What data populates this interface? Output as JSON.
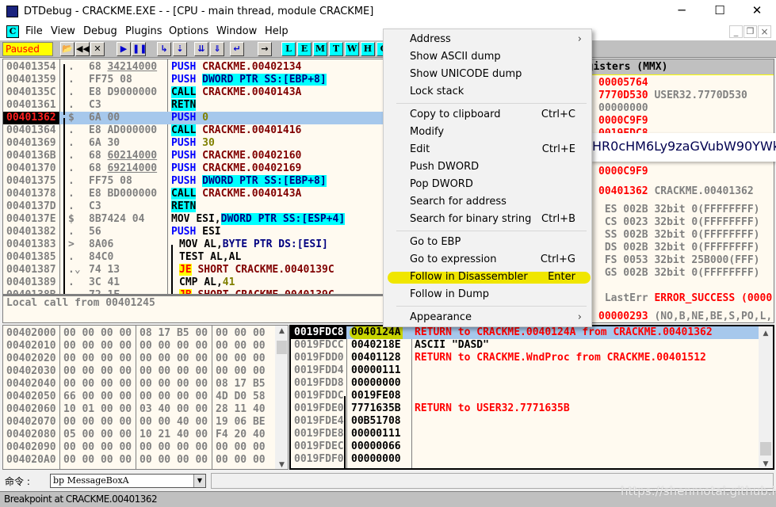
{
  "window": {
    "title": "DTDebug - CRACKME.EXE - - [CPU - main thread, module CRACKME]",
    "minimize": "─",
    "maximize": "☐",
    "close": "✕"
  },
  "menubar": {
    "icon": "C",
    "items": [
      "File",
      "View",
      "Debug",
      "Plugins",
      "Options",
      "Window",
      "Help"
    ],
    "mdi": [
      "_",
      "❐",
      "×"
    ]
  },
  "toolbar": {
    "status": "Paused",
    "status_color": "#ffff00",
    "buttons": [
      {
        "name": "open-icon",
        "g": "📂"
      },
      {
        "name": "restart-icon",
        "g": "◀◀"
      },
      {
        "name": "close-icon",
        "g": "✕"
      },
      {
        "name": "run-icon",
        "g": "▶"
      },
      {
        "name": "pause-icon",
        "g": "❚❚"
      },
      {
        "name": "step-into-icon",
        "g": "↳"
      },
      {
        "name": "step-over-icon",
        "g": "⇣"
      },
      {
        "name": "trace-into-icon",
        "g": "⇊"
      },
      {
        "name": "trace-over-icon",
        "g": "⇓"
      },
      {
        "name": "execute-till-return-icon",
        "g": "↵"
      },
      {
        "name": "goto-icon",
        "g": "→"
      }
    ],
    "letters": [
      "L",
      "E",
      "M",
      "T",
      "W",
      "H",
      "C"
    ]
  },
  "disasm": {
    "rows": [
      {
        "addr": "00401354",
        "mark": ".",
        "h1": "68 ",
        "h2": "34214000",
        "mn": "PUSH",
        "mc": "push",
        "ops": [
          [
            "CRACKME.00402134",
            "red"
          ]
        ]
      },
      {
        "addr": "00401359",
        "mark": ".",
        "h1": "FF75 08",
        "h2": "",
        "mn": "PUSH",
        "mc": "push",
        "ops": [
          [
            "DWORD PTR SS:[EBP+8]",
            "navyc"
          ]
        ]
      },
      {
        "addr": "0040135C",
        "mark": ".",
        "h1": "E8 D9000000",
        "h2": "",
        "mn": "CALL",
        "mc": "cyan",
        "ops": [
          [
            "CRACKME.0040143A",
            "red"
          ]
        ]
      },
      {
        "addr": "00401361",
        "mark": ".",
        "h1": "C3",
        "h2": "",
        "mn": "RETN",
        "mc": "cyan",
        "ops": []
      },
      {
        "addr": "00401362",
        "mark": "$",
        "h1": "6A 00",
        "h2": "",
        "mn": "PUSH",
        "mc": "push",
        "ops": [
          [
            "0",
            "olive"
          ]
        ],
        "selected": true
      },
      {
        "addr": "00401364",
        "mark": ".",
        "h1": "E8 AD000000",
        "h2": "",
        "mn": "CALL",
        "mc": "cyan",
        "ops": [
          [
            "CRACKME.00401416",
            "red"
          ]
        ]
      },
      {
        "addr": "00401369",
        "mark": ".",
        "h1": "6A 30",
        "h2": "",
        "mn": "PUSH",
        "mc": "push",
        "ops": [
          [
            "30",
            "olive"
          ]
        ]
      },
      {
        "addr": "0040136B",
        "mark": ".",
        "h1": "68 ",
        "h2": "60214000",
        "mn": "PUSH",
        "mc": "push",
        "ops": [
          [
            "CRACKME.00402160",
            "red"
          ]
        ]
      },
      {
        "addr": "00401370",
        "mark": ".",
        "h1": "68 ",
        "h2": "69214000",
        "mn": "PUSH",
        "mc": "push",
        "ops": [
          [
            "CRACKME.00402169",
            "red"
          ]
        ]
      },
      {
        "addr": "00401375",
        "mark": ".",
        "h1": "FF75 08",
        "h2": "",
        "mn": "PUSH",
        "mc": "push",
        "ops": [
          [
            "DWORD PTR SS:[EBP+8]",
            "navyc"
          ]
        ]
      },
      {
        "addr": "00401378",
        "mark": ".",
        "h1": "E8 BD000000",
        "h2": "",
        "mn": "CALL",
        "mc": "cyan",
        "ops": [
          [
            "CRACKME.0040143A",
            "red"
          ]
        ]
      },
      {
        "addr": "0040137D",
        "mark": ".",
        "h1": "C3",
        "h2": "",
        "mn": "RETN",
        "mc": "cyan",
        "ops": []
      },
      {
        "addr": "0040137E",
        "mark": "$",
        "h1": "8B7424 04",
        "h2": "",
        "mn": "MOV",
        "mc": "blk",
        "ops": [
          [
            "ESI,",
            "blk"
          ],
          [
            "DWORD PTR SS:[ESP+4]",
            "navyc"
          ]
        ]
      },
      {
        "addr": "00401382",
        "mark": ".",
        "h1": "56",
        "h2": "",
        "mn": "PUSH",
        "mc": "push",
        "ops": [
          [
            "ESI",
            "blk"
          ]
        ]
      },
      {
        "addr": "00401383",
        "mark": ">",
        "h1": "8A06",
        "h2": "",
        "mn": "MOV",
        "mc": "blk",
        "ops": [
          [
            "AL,",
            "blk"
          ],
          [
            "BYTE PTR DS:[ESI]",
            "navy"
          ]
        ],
        "indent": true
      },
      {
        "addr": "00401385",
        "mark": ".",
        "h1": "84C0",
        "h2": "",
        "mn": "TEST",
        "mc": "blk",
        "ops": [
          [
            "AL,AL",
            "blk"
          ]
        ],
        "indent": true
      },
      {
        "addr": "00401387",
        "mark": ".⌄",
        "h1": "74 13",
        "h2": "",
        "mn": "JE",
        "mc": "jmp",
        "ops": [
          [
            "SHORT CRACKME.0040139C",
            "red"
          ]
        ],
        "indent": true
      },
      {
        "addr": "00401389",
        "mark": ".",
        "h1": "3C 41",
        "h2": "",
        "mn": "CMP",
        "mc": "blk",
        "ops": [
          [
            "AL,",
            "blk"
          ],
          [
            "41",
            "olive"
          ]
        ],
        "indent": true
      },
      {
        "addr": "0040138B",
        "mark": ".",
        "h1": "72 1F",
        "h2": "",
        "mn": "JB",
        "mc": "jmp",
        "ops": [
          [
            "SHORT CRACKME.0040139C",
            "red"
          ]
        ],
        "indent": true
      }
    ]
  },
  "info": {
    "text": "Local call from 00401245"
  },
  "registers": {
    "header": "Registers (MMX)",
    "rows": [
      {
        "v": "00005764",
        "c": "rr",
        "d": ""
      },
      {
        "v": "7770D530",
        "c": "rr",
        "d": "USER32.7770D530"
      },
      {
        "v": "00000000",
        "c": "gray",
        "d": ""
      },
      {
        "v": "0000C9F9",
        "c": "rr",
        "d": ""
      },
      {
        "v": "0019FDC8",
        "c": "rr",
        "d": ""
      },
      {
        "v": "0000C9F9",
        "c": "rr",
        "d": "",
        "gap": true
      },
      {
        "v": "00401362",
        "c": "rr",
        "d": "CRACKME.00401362"
      }
    ],
    "segments": [
      " ES 002B 32bit 0(FFFFFFFF)",
      " CS 0023 32bit 0(FFFFFFFF)",
      " SS 002B 32bit 0(FFFFFFFF)",
      " DS 002B 32bit 0(FFFFFFFF)",
      " FS 0053 32bit 25B000(FFF)",
      " GS 002B 32bit 0(FFFFFFFF)"
    ],
    "lasterr_label": " LastErr",
    "lasterr": "ERROR_SUCCESS (0000",
    "eflags": "00000293",
    "flags": "(NO,B,NE,BE,S,PO,L,"
  },
  "tooltip": {
    "text": "HR0cHM6Ly9zaGVubW90YWkuZ"
  },
  "dump": {
    "rows": [
      [
        "00402000",
        "00 00 00 00",
        "08 17 B5 00",
        "00 00 00"
      ],
      [
        "00402010",
        "00 00 00 00",
        "00 00 00 00",
        "00 00 00"
      ],
      [
        "00402020",
        "00 00 00 00",
        "00 00 00 00",
        "00 00 00"
      ],
      [
        "00402030",
        "00 00 00 00",
        "00 00 00 00",
        "00 00 00"
      ],
      [
        "00402040",
        "00 00 00 00",
        "00 00 00 00",
        "08 17 B5"
      ],
      [
        "00402050",
        "66 00 00 00",
        "00 00 00 00",
        "4D D0 58"
      ],
      [
        "00402060",
        "10 01 00 00",
        "03 40 00 00",
        "28 11 40"
      ],
      [
        "00402070",
        "00 00 00 00",
        "00 00 40 00",
        "19 06 BE"
      ],
      [
        "00402080",
        "05 00 00 00",
        "10 21 40 00",
        "F4 20 40"
      ],
      [
        "00402090",
        "00 00 00 00",
        "00 00 00 00",
        "00 00 00"
      ],
      [
        "004020A0",
        "00 00 00 00",
        "00 00 00 00",
        "00 00 00"
      ]
    ]
  },
  "stack": {
    "rows": [
      [
        "0019FDC8",
        "0040124A",
        "RETURN to CRACKME.0040124A from CRACKME.00401362",
        "rr"
      ],
      [
        "0019FDCC",
        "0040218E",
        "ASCII \"DASD\"",
        "blk"
      ],
      [
        "0019FDD0",
        "00401128",
        "RETURN to CRACKME.WndProc from CRACKME.00401512",
        "rr"
      ],
      [
        "0019FDD4",
        "00000111",
        "",
        ""
      ],
      [
        "0019FDD8",
        "00000000",
        "",
        ""
      ],
      [
        "0019FDDC",
        "0019FE08",
        "",
        ""
      ],
      [
        "0019FDE0",
        "7771635B",
        "RETURN to USER32.7771635B",
        "rr"
      ],
      [
        "0019FDE4",
        "00B51708",
        "",
        ""
      ],
      [
        "0019FDE8",
        "00000111",
        "",
        ""
      ],
      [
        "0019FDEC",
        "00000066",
        "",
        ""
      ],
      [
        "0019FDF0",
        "00000000",
        "",
        ""
      ]
    ]
  },
  "context_menu": {
    "items": [
      {
        "label": "Address",
        "shortcut": "",
        "sub": true
      },
      {
        "label": "Show ASCII dump",
        "shortcut": ""
      },
      {
        "label": "Show UNICODE dump",
        "shortcut": ""
      },
      {
        "label": "Lock stack",
        "shortcut": ""
      },
      {
        "sep": true
      },
      {
        "label": "Copy to clipboard",
        "shortcut": "Ctrl+C"
      },
      {
        "label": "Modify",
        "shortcut": ""
      },
      {
        "label": "Edit",
        "shortcut": "Ctrl+E"
      },
      {
        "label": "Push DWORD",
        "shortcut": ""
      },
      {
        "label": "Pop DWORD",
        "shortcut": ""
      },
      {
        "label": "Search for address",
        "shortcut": ""
      },
      {
        "label": "Search for binary string",
        "shortcut": "Ctrl+B"
      },
      {
        "sep": true
      },
      {
        "label": "Go to EBP",
        "shortcut": ""
      },
      {
        "label": "Go to expression",
        "shortcut": "Ctrl+G"
      },
      {
        "label": "Follow in Disassembler",
        "shortcut": "Enter",
        "highlight": true
      },
      {
        "label": "Follow in Dump",
        "shortcut": ""
      },
      {
        "sep": true
      },
      {
        "label": "Appearance",
        "shortcut": "",
        "sub": true
      }
    ]
  },
  "command": {
    "label": "命令 :",
    "value": "bp MessageBoxA"
  },
  "statusbar": {
    "text": "Breakpoint at CRACKME.00401362",
    "watermark": "https://shenmotai.github.io"
  },
  "colors": {
    "pane_bg": "#fffaf0",
    "selection": "#a6c8ec",
    "highlight": "#f0e600"
  }
}
